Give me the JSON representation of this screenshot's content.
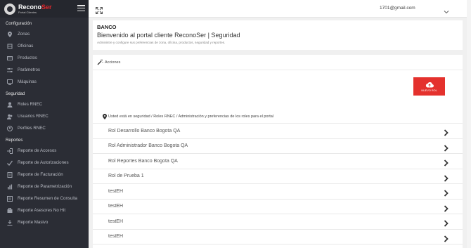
{
  "brand": {
    "name_main": "Recono",
    "name_accent": "Ser",
    "subtitle": "Portal Clientes"
  },
  "sidebar": {
    "sections": [
      {
        "title": "Configuración",
        "items": [
          {
            "label": "Zonas",
            "icon": "map-pin-icon"
          },
          {
            "label": "Oficinas",
            "icon": "office-icon"
          },
          {
            "label": "Productos",
            "icon": "products-icon"
          },
          {
            "label": "Parámetros",
            "icon": "sliders-icon"
          },
          {
            "label": "Máquinas",
            "icon": "machine-icon"
          }
        ]
      },
      {
        "title": "Seguridad",
        "items": [
          {
            "label": "Roles RNEC",
            "icon": "users-icon"
          },
          {
            "label": "Usuarios RNEC",
            "icon": "users-icon"
          },
          {
            "label": "Perfiles RNEC",
            "icon": "profile-icon"
          }
        ]
      },
      {
        "title": "Reportes",
        "items": [
          {
            "label": "Reporte de Accesos",
            "icon": "login-icon"
          },
          {
            "label": "Reporte de Autorizaciones",
            "icon": "check-icon"
          },
          {
            "label": "Reporte de Facturación",
            "icon": "invoice-icon"
          },
          {
            "label": "Reporte de Parametrización",
            "icon": "chart-icon"
          },
          {
            "label": "Reporte Resumen de Consulta",
            "icon": "summary-icon"
          },
          {
            "label": "Reporte Asesores No Hit",
            "icon": "ban-icon"
          },
          {
            "label": "Reporte Masivo",
            "icon": "download-icon"
          }
        ]
      }
    ]
  },
  "topbar": {
    "user_email": "1701@gmail.com"
  },
  "header": {
    "company": "BANCO",
    "title": "Bienvenido al portal cliente ReconoSer | Seguridad",
    "description": "Administre y configure sus preferencias de zona, oficina, productos, seguridad y reportes."
  },
  "actions": {
    "title": "Acciones",
    "new_role_label": "NUEVO ROL"
  },
  "roles": {
    "breadcrumb": "Usted está en seguridad / Roles RNEC / Administración y preferencias de los roles para el portal",
    "items": [
      "Rol Desarrollo Banco Bogota QA",
      "Rol Administrador Banco Bogota QA",
      "Rol Reportes Banco Bogota QA",
      "Rol de Prueba 1",
      "testEH",
      "testEH",
      "testEH",
      "testEH"
    ]
  },
  "colors": {
    "accent": "#e4312d",
    "sidebar_bg": "#2b2d35"
  }
}
